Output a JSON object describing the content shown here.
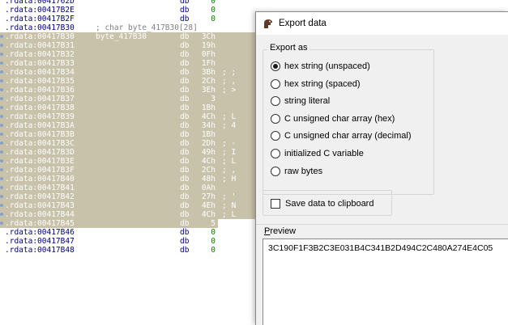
{
  "listing": {
    "rows": [
      {
        "addr": ".rdata:0041762D",
        "label": "",
        "mnemonic": "db",
        "operand": "0",
        "chr": "",
        "selected": false,
        "partial": true
      },
      {
        "addr": ".rdata:00417B2E",
        "label": "",
        "mnemonic": "db",
        "operand": "0",
        "chr": "",
        "selected": false
      },
      {
        "addr": ".rdata:00417B2F",
        "label": "",
        "mnemonic": "db",
        "operand": "0",
        "chr": "",
        "selected": false
      },
      {
        "addr": ".rdata:00417B30",
        "label": "",
        "comment": "; char byte_417B30[28]",
        "mnemonic": "",
        "operand": "",
        "chr": "",
        "selected": false
      },
      {
        "addr": ".rdata:00417B30",
        "label": "byte_417B30",
        "mnemonic": "db",
        "operand": "3Ch",
        "chr": "",
        "selected": true
      },
      {
        "addr": ".rdata:00417B31",
        "label": "",
        "mnemonic": "db",
        "operand": "19h",
        "chr": "",
        "selected": true
      },
      {
        "addr": ".rdata:00417B32",
        "label": "",
        "mnemonic": "db",
        "operand": "0Fh",
        "chr": "",
        "selected": true
      },
      {
        "addr": ".rdata:00417B33",
        "label": "",
        "mnemonic": "db",
        "operand": "1Fh",
        "chr": "",
        "selected": true
      },
      {
        "addr": ".rdata:00417B34",
        "label": "",
        "mnemonic": "db",
        "operand": "3Bh",
        "chr": "; ;",
        "selected": true
      },
      {
        "addr": ".rdata:00417B35",
        "label": "",
        "mnemonic": "db",
        "operand": "2Ch",
        "chr": "; ,",
        "selected": true
      },
      {
        "addr": ".rdata:00417B36",
        "label": "",
        "mnemonic": "db",
        "operand": "3Eh",
        "chr": "; >",
        "selected": true
      },
      {
        "addr": ".rdata:00417B37",
        "label": "",
        "mnemonic": "db",
        "operand": "3",
        "chr": "",
        "selected": true
      },
      {
        "addr": ".rdata:00417B38",
        "label": "",
        "mnemonic": "db",
        "operand": "1Bh",
        "chr": "",
        "selected": true
      },
      {
        "addr": ".rdata:00417B39",
        "label": "",
        "mnemonic": "db",
        "operand": "4Ch",
        "chr": "; L",
        "selected": true
      },
      {
        "addr": ".rdata:00417B3A",
        "label": "",
        "mnemonic": "db",
        "operand": "34h",
        "chr": "; 4",
        "selected": true
      },
      {
        "addr": ".rdata:00417B3B",
        "label": "",
        "mnemonic": "db",
        "operand": "1Bh",
        "chr": "",
        "selected": true
      },
      {
        "addr": ".rdata:00417B3C",
        "label": "",
        "mnemonic": "db",
        "operand": "2Dh",
        "chr": "; -",
        "selected": true
      },
      {
        "addr": ".rdata:00417B3D",
        "label": "",
        "mnemonic": "db",
        "operand": "49h",
        "chr": "; I",
        "selected": true
      },
      {
        "addr": ".rdata:00417B3E",
        "label": "",
        "mnemonic": "db",
        "operand": "4Ch",
        "chr": "; L",
        "selected": true
      },
      {
        "addr": ".rdata:00417B3F",
        "label": "",
        "mnemonic": "db",
        "operand": "2Ch",
        "chr": "; ,",
        "selected": true
      },
      {
        "addr": ".rdata:00417B40",
        "label": "",
        "mnemonic": "db",
        "operand": "48h",
        "chr": "; H",
        "selected": true
      },
      {
        "addr": ".rdata:00417B41",
        "label": "",
        "mnemonic": "db",
        "operand": "0Ah",
        "chr": "",
        "selected": true
      },
      {
        "addr": ".rdata:00417B42",
        "label": "",
        "mnemonic": "db",
        "operand": "27h",
        "chr": "; '",
        "selected": true
      },
      {
        "addr": ".rdata:00417B43",
        "label": "",
        "mnemonic": "db",
        "operand": "4Eh",
        "chr": "; N",
        "selected": true
      },
      {
        "addr": ".rdata:00417B44",
        "label": "",
        "mnemonic": "db",
        "operand": "4Ch",
        "chr": "; L",
        "selected": true
      },
      {
        "addr": ".rdata:00417B45",
        "label": "",
        "mnemonic": "db",
        "operand": "5",
        "chr": "",
        "selected": true,
        "shortband": true
      },
      {
        "addr": ".rdata:00417B46",
        "label": "",
        "mnemonic": "db",
        "operand": "0",
        "chr": "",
        "selected": false
      },
      {
        "addr": ".rdata:00417B47",
        "label": "",
        "mnemonic": "db",
        "operand": "0",
        "chr": "",
        "selected": false
      },
      {
        "addr": ".rdata:00417B48",
        "label": "",
        "mnemonic": "db",
        "operand": "0",
        "chr": "",
        "selected": false
      }
    ]
  },
  "dialog": {
    "title": "Export data",
    "icon": "ida-icon",
    "export_as_label": "Export as",
    "options": [
      {
        "label": "hex string (unspaced)",
        "checked": true
      },
      {
        "label": "hex string (spaced)",
        "checked": false
      },
      {
        "label": "string literal",
        "checked": false
      },
      {
        "label": "C unsigned char array (hex)",
        "checked": false
      },
      {
        "label": "C unsigned char array (decimal)",
        "checked": false
      },
      {
        "label": "initialized C variable",
        "checked": false
      },
      {
        "label": "raw bytes",
        "checked": false
      }
    ],
    "clipboard_label": "Save data to clipboard",
    "clipboard_checked": false,
    "preview_label_accel": "P",
    "preview_label_rest": "review",
    "preview_text": "3C190F1F3B2C3E031B4C341B2D494C2C480A274E4C05"
  }
}
